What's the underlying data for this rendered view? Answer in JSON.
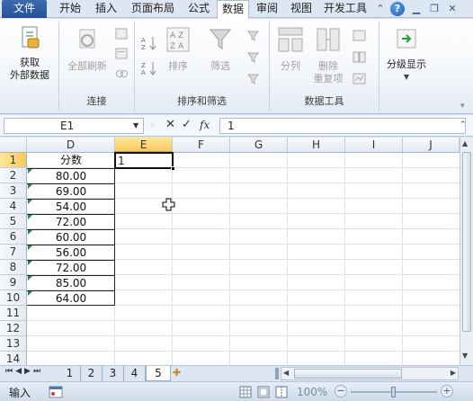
{
  "tabs": {
    "file": "文件",
    "home": "开始",
    "insert": "插入",
    "layout": "页面布局",
    "formulas": "公式",
    "data": "数据",
    "review": "审阅",
    "view": "视图",
    "developer": "开发工具",
    "help": "?"
  },
  "ribbon": {
    "get_external": "获取\n外部数据",
    "get_external_line1": "获取",
    "get_external_line2": "外部数据",
    "refresh_all": "全部刷新",
    "group_connections": "连接",
    "sort": "排序",
    "filter": "筛选",
    "group_sort_filter": "排序和筛选",
    "text_to_columns": "分列",
    "remove_duplicates_line1": "删除",
    "remove_duplicates_line2": "重复项",
    "group_data_tools": "数据工具",
    "outline": "分级显示",
    "sort_az_top": "A",
    "sort_az_bottom": "Z",
    "sort_az_box": "AZ"
  },
  "formula_bar": {
    "name_box": "E1",
    "cancel": "✕",
    "enter": "✓",
    "fx": "fx",
    "content": "1"
  },
  "columns": [
    "D",
    "E",
    "F",
    "G",
    "H",
    "I",
    "J"
  ],
  "selected_column": "E",
  "rows": [
    "1",
    "2",
    "3",
    "4",
    "5",
    "6",
    "7",
    "8",
    "9",
    "10",
    "11",
    "12",
    "13",
    "14"
  ],
  "selected_row": "1",
  "cells": {
    "D_header": "分数",
    "D_values": [
      "80.00",
      "69.00",
      "54.00",
      "72.00",
      "60.00",
      "56.00",
      "72.00",
      "85.00",
      "64.00"
    ],
    "E1": "1"
  },
  "sheets": [
    "1",
    "2",
    "3",
    "4",
    "5"
  ],
  "active_sheet": "5",
  "status": {
    "mode": "输入",
    "zoom": "100%",
    "zoom_out": "−",
    "zoom_in": "+"
  },
  "colors": {
    "file_tab": "#2b579a",
    "selection_header": "#f9c85a",
    "number_marker": "#1f8a3a"
  }
}
